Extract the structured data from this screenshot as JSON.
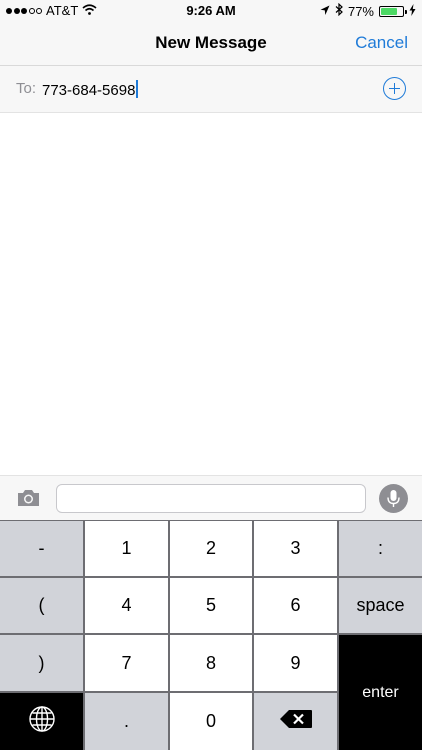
{
  "status_bar": {
    "carrier": "AT&T",
    "time": "9:26 AM",
    "battery_percent": "77%",
    "battery_level": 0.77,
    "signal_bars_filled": 3,
    "signal_bars_total": 5,
    "icons": [
      "wifi-icon",
      "location-arrow-icon",
      "bluetooth-icon",
      "battery-icon",
      "charging-bolt-icon"
    ]
  },
  "nav": {
    "title": "New Message",
    "cancel_label": "Cancel"
  },
  "to_field": {
    "label": "To:",
    "value": "773-684-5698",
    "add_icon": "add-contact-icon"
  },
  "input_bar": {
    "camera_icon": "camera-icon",
    "message_value": "",
    "mic_icon": "microphone-icon"
  },
  "keypad": {
    "keys": {
      "minus": "-",
      "one": "1",
      "two": "2",
      "three": "3",
      "colon": ":",
      "open_paren": "(",
      "four": "4",
      "five": "5",
      "six": "6",
      "space": "space",
      "close_paren": ")",
      "seven": "7",
      "eight": "8",
      "nine": "9",
      "enter": "enter",
      "period": ".",
      "zero": "0"
    },
    "globe_icon": "globe-icon",
    "delete_icon": "delete-icon"
  },
  "colors": {
    "accent": "#1f7bd8",
    "battery_fill": "#4cd964",
    "key_white": "#ffffff",
    "key_gray": "#d1d3d9",
    "key_dark": "#000000",
    "keypad_separator": "#6d6d72"
  }
}
